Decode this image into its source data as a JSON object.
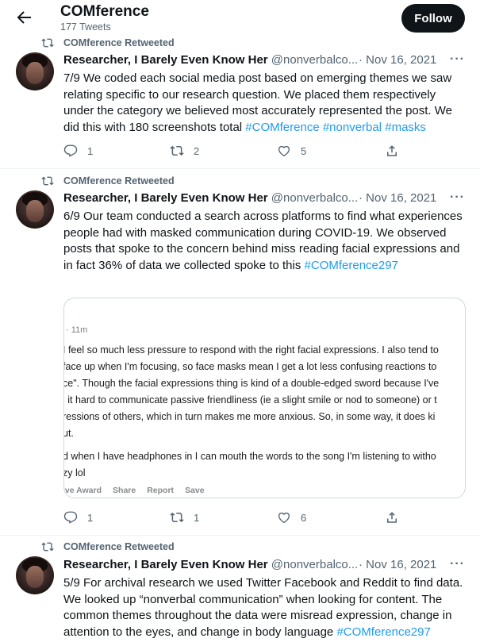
{
  "header": {
    "account_name": "COMference",
    "tweet_count": "177 Tweets",
    "follow_label": "Follow"
  },
  "tweets": [
    {
      "retweeted_by": "COMference Retweeted",
      "display_name": "Researcher, I Barely Even Know Her",
      "handle": "@nonverbalco...",
      "date": "· Nov 16, 2021",
      "more": "···",
      "text": "7/9 We coded each social media post based on emerging themes we saw relating specific to our research question. We placed them respectively under the category we believed most accurately represented the post. We did this with 180 screenshots total ",
      "hashtags": [
        "#COMference",
        "#nonverbal",
        "#masks"
      ],
      "replies": "1",
      "retweets": "2",
      "likes": "5"
    },
    {
      "retweeted_by": "COMference Retweeted",
      "display_name": "Researcher, I Barely Even Know Her",
      "handle": "@nonverbalco...",
      "date": "· Nov 16, 2021",
      "more": "···",
      "text": "6/9 Our team conducted a search across platforms to find what experiences people had with masked communication during COVID-19. We observed posts that spoke to the concern behind miss reading facial expressions and in fact 36% of data we collected spoke to this ",
      "hashtags": [
        "#COMference297"
      ],
      "replies": "1",
      "retweets": "1",
      "likes": "6",
      "media": {
        "time": "· 11m",
        "lines": [
          "I feel so much less pressure to respond with the right facial expressions. I also tend to",
          "face up when I'm focusing, so face masks mean I get a lot less confusing reactions to",
          "ce\". Though the facial expressions thing is kind of a double-edged sword because I've",
          "l it hard to communicate passive friendliness (ie a slight smile or nod to someone) or t",
          "ressions of others, which in turn makes me more anxious. So, in some way, it does ki",
          "ut.",
          "d when I have headphones in I can mouth the words to the song I'm listening to witho",
          "zy lol"
        ],
        "actions": [
          "ive Award",
          "Share",
          "Report",
          "Save"
        ]
      }
    },
    {
      "retweeted_by": "COMference Retweeted",
      "display_name": "Researcher, I Barely Even Know Her",
      "handle": "@nonverbalco...",
      "date": "· Nov 16, 2021",
      "more": "···",
      "text": "5/9 For archival research we used Twitter Facebook and Reddit to find data. We looked up “nonverbal communication” when looking for content. The common themes throughout the data were misread expression, change in attention to the eyes, and change in body language ",
      "hashtags": [
        "#COMference297"
      ]
    }
  ],
  "icons": [
    "back-arrow-icon",
    "retweet-icon",
    "reply-icon",
    "like-icon",
    "share-icon"
  ],
  "colors": {
    "link": "#1d9bf0",
    "muted": "#536471",
    "follow_bg": "#0f1419"
  }
}
